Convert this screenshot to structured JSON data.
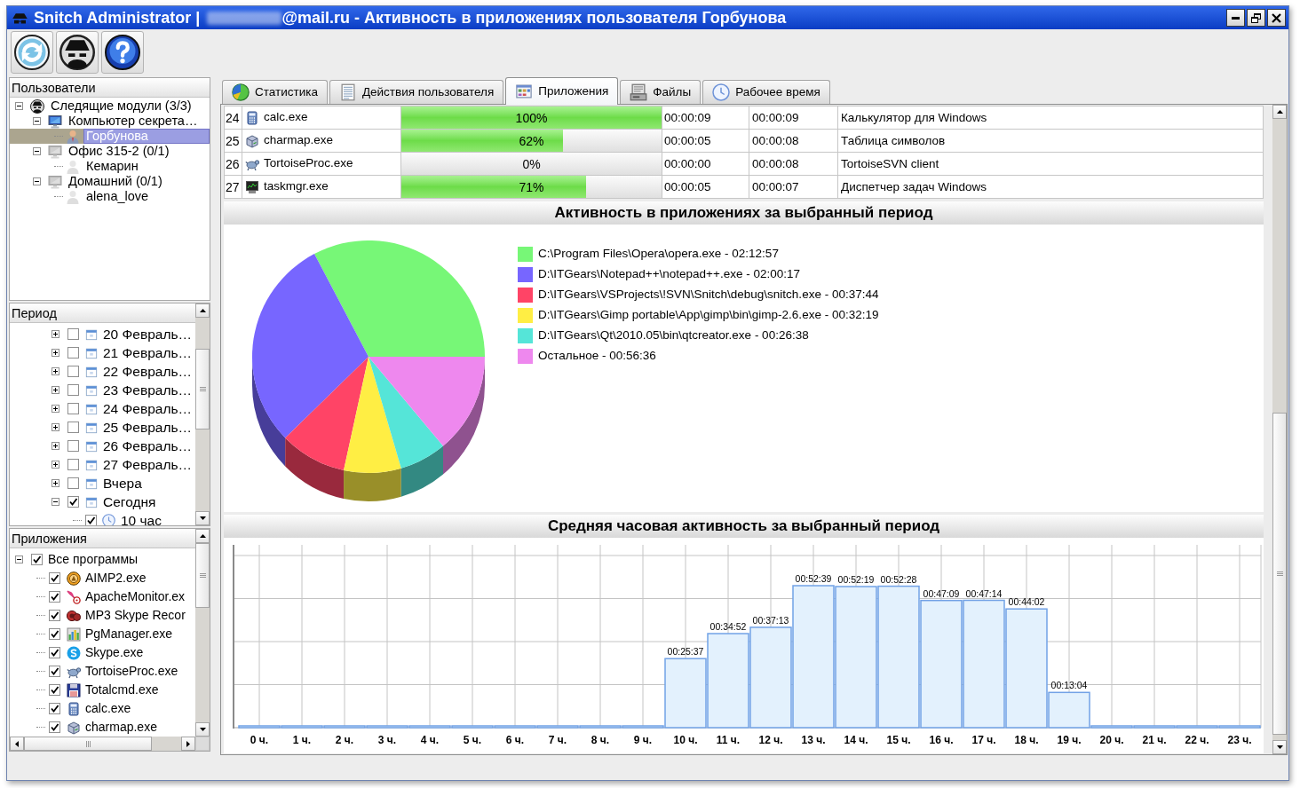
{
  "window": {
    "title_app": "Snitch Administrator |",
    "title_rest": "@mail.ru - Активность в приложениях пользователя Горбунова"
  },
  "users_panel": {
    "header": "Пользователи",
    "tree": [
      {
        "label": "Следящие модули (3/3)",
        "kind": "group",
        "selected": false,
        "expanded": true,
        "children": [
          {
            "label": "Компьютер секрета…",
            "kind": "computer",
            "online": true,
            "selected": false,
            "expanded": true,
            "children": [
              {
                "label": "Горбунова",
                "kind": "user",
                "online": true,
                "selected": true
              }
            ]
          },
          {
            "label": "Офис 315-2 (0/1)",
            "kind": "computer",
            "online": false,
            "selected": false,
            "expanded": true,
            "children": [
              {
                "label": "Кемарин",
                "kind": "user",
                "online": false,
                "selected": false
              }
            ]
          },
          {
            "label": "Домашний (0/1)",
            "kind": "computer",
            "online": false,
            "selected": false,
            "expanded": true,
            "children": [
              {
                "label": "alena_love",
                "kind": "user",
                "online": false,
                "selected": false
              }
            ]
          }
        ]
      }
    ]
  },
  "period_panel": {
    "header": "Период",
    "tree": [
      {
        "label": "20 Февраль…",
        "checked": false,
        "expanded": false
      },
      {
        "label": "21 Февраль…",
        "checked": false,
        "expanded": false
      },
      {
        "label": "22 Февраль…",
        "checked": false,
        "expanded": false
      },
      {
        "label": "23 Февраль…",
        "checked": false,
        "expanded": false
      },
      {
        "label": "24 Февраль…",
        "checked": false,
        "expanded": false
      },
      {
        "label": "25 Февраль…",
        "checked": false,
        "expanded": false
      },
      {
        "label": "26 Февраль…",
        "checked": false,
        "expanded": false
      },
      {
        "label": "27 Февраль…",
        "checked": false,
        "expanded": false
      },
      {
        "label": "Вчера",
        "checked": false,
        "expanded": false
      },
      {
        "label": "Сегодня",
        "checked": true,
        "expanded": true,
        "children": [
          {
            "label": "10 час",
            "checked": true
          }
        ]
      }
    ]
  },
  "apps_panel": {
    "header": "Приложения",
    "tree": [
      {
        "label": "Все программы",
        "checked": true,
        "expanded": true,
        "children": [
          {
            "label": "AIMP2.exe",
            "checked": true
          },
          {
            "label": "ApacheMonitor.ex",
            "checked": true
          },
          {
            "label": "MP3 Skype Recor",
            "checked": true
          },
          {
            "label": "PgManager.exe",
            "checked": true
          },
          {
            "label": "Skype.exe",
            "checked": true
          },
          {
            "label": "TortoiseProc.exe",
            "checked": true
          },
          {
            "label": "Totalcmd.exe",
            "checked": true
          },
          {
            "label": "calc.exe",
            "checked": true
          },
          {
            "label": "charmap.exe",
            "checked": true
          }
        ]
      }
    ]
  },
  "tabs": [
    {
      "label": "Статистика",
      "selected": false
    },
    {
      "label": "Действия пользователя",
      "selected": false
    },
    {
      "label": "Приложения",
      "selected": true
    },
    {
      "label": "Файлы",
      "selected": false
    },
    {
      "label": "Рабочее время",
      "selected": false
    }
  ],
  "table": {
    "rows": [
      {
        "number": "24",
        "application": "calc.exe",
        "activity": "100%",
        "level": 1,
        "column_4": "00:00:09",
        "column_5": "00:00:09",
        "description": "Калькулятор для Windows"
      },
      {
        "number": "25",
        "application": "charmap.exe",
        "activity": "62%",
        "level": 0.62,
        "column_4": "00:00:05",
        "column_5": "00:00:08",
        "description": "Таблица символов"
      },
      {
        "number": "26",
        "application": "TortoiseProc.exe",
        "activity": "0%",
        "level": 0,
        "column_4": "00:00:00",
        "column_5": "00:00:08",
        "description": "TortoiseSVN client"
      },
      {
        "number": "27",
        "application": "taskmgr.exe",
        "activity": "71%",
        "level": 0.71,
        "column_4": "00:00:05",
        "column_5": "00:00:07",
        "description": "Диспетчер задач Windows"
      }
    ]
  },
  "activity_section": {
    "chart_data": {
      "type": "pie",
      "title": "Активность в приложениях за выбранный период",
      "categories": [
        "C:\\Program Files\\Opera\\opera.exe - 02:12:57",
        "D:\\ITGears\\Notepad++\\notepad++.exe - 02:00:17",
        "D:\\ITGears\\VSProjects\\!SVN\\Snitch\\debug\\snitch.exe - 00:37:44",
        "D:\\ITGears\\Gimp portable\\App\\gimp\\bin\\gimp-2.6.exe - 00:32:19",
        "D:\\ITGears\\Qt\\2010.05\\bin\\qtcreator.exe - 00:26:38",
        "Остальное - 00:56:36"
      ],
      "values": [
        32.71,
        29.59,
        9.28,
        7.95,
        6.55,
        13.92
      ],
      "colors": [
        "#77f777",
        "#7766ff",
        "#ff4466",
        "#ffee44",
        "#55e5d8",
        "#ee88ee"
      ],
      "legend": "right"
    }
  },
  "hourly_section": {
    "chart_data": {
      "type": "bar",
      "title": "Средняя часовая активность за выбранный период",
      "categories": [
        "0 ч.",
        "1 ч.",
        "2 ч.",
        "3 ч.",
        "4 ч.",
        "5 ч.",
        "6 ч.",
        "7 ч.",
        "8 ч.",
        "9 ч.",
        "10 ч.",
        "11 ч.",
        "12 ч.",
        "13 ч.",
        "14 ч.",
        "15 ч.",
        "16 ч.",
        "17 ч.",
        "18 ч.",
        "19 ч.",
        "20 ч.",
        "21 ч.",
        "22 ч.",
        "23 ч."
      ],
      "values": [
        0,
        0,
        0,
        0,
        0,
        0,
        0,
        0,
        0,
        0,
        1537,
        2092,
        2233,
        3159,
        3139,
        3148,
        2829,
        2834,
        2642,
        784,
        0,
        0,
        0,
        0
      ],
      "value_labels": [
        null,
        null,
        null,
        null,
        null,
        null,
        null,
        null,
        null,
        null,
        "00:25:37",
        "00:34:52",
        "00:37:13",
        "00:52:39",
        "00:52:19",
        "00:52:28",
        "00:47:09",
        "00:47:14",
        "00:44:02",
        "00:13:04",
        null,
        null,
        null,
        null
      ],
      "grid": true
    }
  }
}
